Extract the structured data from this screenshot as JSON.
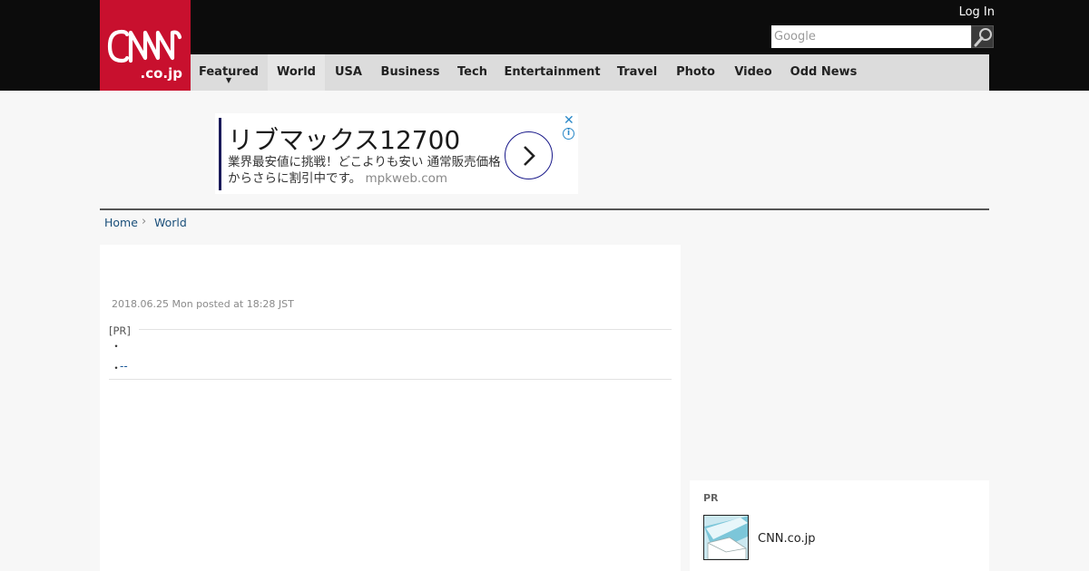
{
  "header": {
    "logo_main": "CNN",
    "logo_sub": ".co.jp",
    "login_label": "Log In",
    "search": {
      "placeholder": "Google",
      "icon": "search-icon"
    }
  },
  "nav": {
    "items": [
      {
        "label": "Featured",
        "has_dropdown": true
      },
      {
        "label": "World",
        "active": true
      },
      {
        "label": "USA"
      },
      {
        "label": "Business"
      },
      {
        "label": "Tech"
      },
      {
        "label": "Entertainment"
      },
      {
        "label": "Travel"
      },
      {
        "label": "Photo"
      },
      {
        "label": "Video"
      },
      {
        "label": "Odd News"
      }
    ],
    "dropdown_icon": "chevron-down-icon"
  },
  "ad": {
    "title": "リブマックス12700",
    "body": "業界最安値に挑戦！どこよりも安い 通常販売価格からさらに割引中です。",
    "domain": "mpkweb.com",
    "close_icon": "close-icon",
    "info_icon": "info-icon",
    "arrow_icon": "chevron-right-icon"
  },
  "breadcrumb": {
    "items": [
      "Home",
      "World"
    ],
    "separator_icon": "chevron-right-icon"
  },
  "article": {
    "date": "2018.06.25 Mon posted at 18:28 JST",
    "pr_label": "[PR]",
    "bullets": [
      "・",
      "・"
    ],
    "link_text": "--"
  },
  "sidebar": {
    "pr_label": "PR",
    "item_name": "CNN.co.jp",
    "thumbnail_icon": "mail-thumbnail-icon"
  },
  "colors": {
    "brand_red": "#c8102e",
    "topbar": "#0c0c0c",
    "nav_bg": "#dcdcdc",
    "link": "#1a4f7a"
  }
}
